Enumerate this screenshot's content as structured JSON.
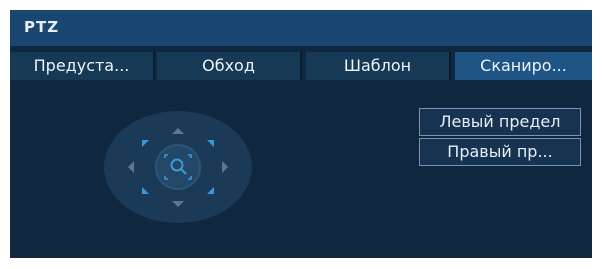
{
  "window": {
    "title": "PTZ"
  },
  "tabs": [
    {
      "label": "Предуста..."
    },
    {
      "label": "Обход"
    },
    {
      "label": "Шаблон"
    },
    {
      "label": "Сканиро..."
    }
  ],
  "active_tab": 3,
  "scan": {
    "left_limit_label": "Левый предел",
    "right_limit_label": "Правый пр..."
  },
  "colors": {
    "panel_bg": "#10283f",
    "titlebar_bg": "#1a4772",
    "tab_bg": "#163956",
    "tab_active_bg": "#1f5585",
    "accent": "#3a9ad8"
  }
}
